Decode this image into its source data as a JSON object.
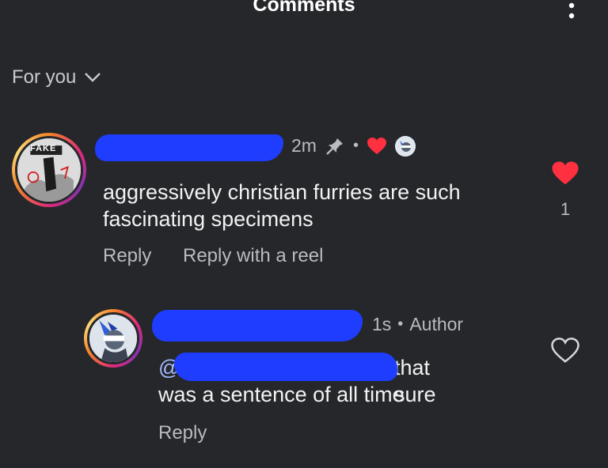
{
  "header": {
    "title": "Comments"
  },
  "filter": {
    "label": "For you"
  },
  "comments": [
    {
      "timestamp": "2m",
      "text_line1": "aggressively christian furries are such",
      "text_line2": "fascinating specimens",
      "avatar_text": "FAKE",
      "like_count": "1",
      "reply_label": "Reply",
      "reply_reel_label": "Reply with a reel",
      "like_color": "#ff3040"
    },
    {
      "timestamp": "1s",
      "role": "Author",
      "mention_prefix": "@",
      "text_tail": "that sure",
      "text_line2": "was a sentence of all time",
      "reply_label": "Reply"
    }
  ]
}
